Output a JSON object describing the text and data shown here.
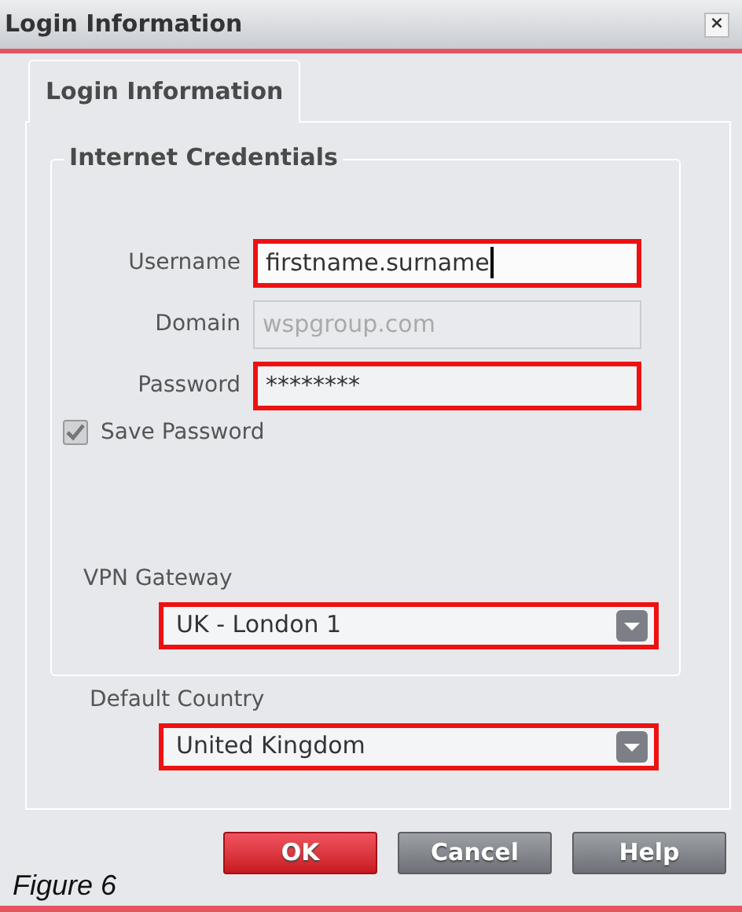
{
  "window": {
    "title": "Login Information",
    "close": "×"
  },
  "tabs": [
    {
      "label": "Login Information",
      "selected": true
    }
  ],
  "group": {
    "title": "Internet Credentials"
  },
  "fields": [
    {
      "label": "Username",
      "value": "firstname.surname",
      "disabled": false,
      "highlighted": true,
      "focused": true
    },
    {
      "label": "Domain",
      "value": "wspgroup.com",
      "disabled": true,
      "highlighted": false,
      "focused": false
    },
    {
      "label": "Password",
      "value": "********",
      "disabled": false,
      "highlighted": true,
      "focused": false
    }
  ],
  "save_password": {
    "label": "Save Password",
    "checked": true
  },
  "vpn_gateway": {
    "label": "VPN Gateway",
    "value": "UK - London 1",
    "highlighted": true
  },
  "default_country": {
    "label": "Default Country",
    "value": "United Kingdom",
    "highlighted": true
  },
  "buttons": [
    {
      "label": "OK",
      "kind": "primary"
    },
    {
      "label": "Cancel",
      "kind": "secondary"
    },
    {
      "label": "Help",
      "kind": "secondary"
    }
  ],
  "caption": "Figure 6"
}
